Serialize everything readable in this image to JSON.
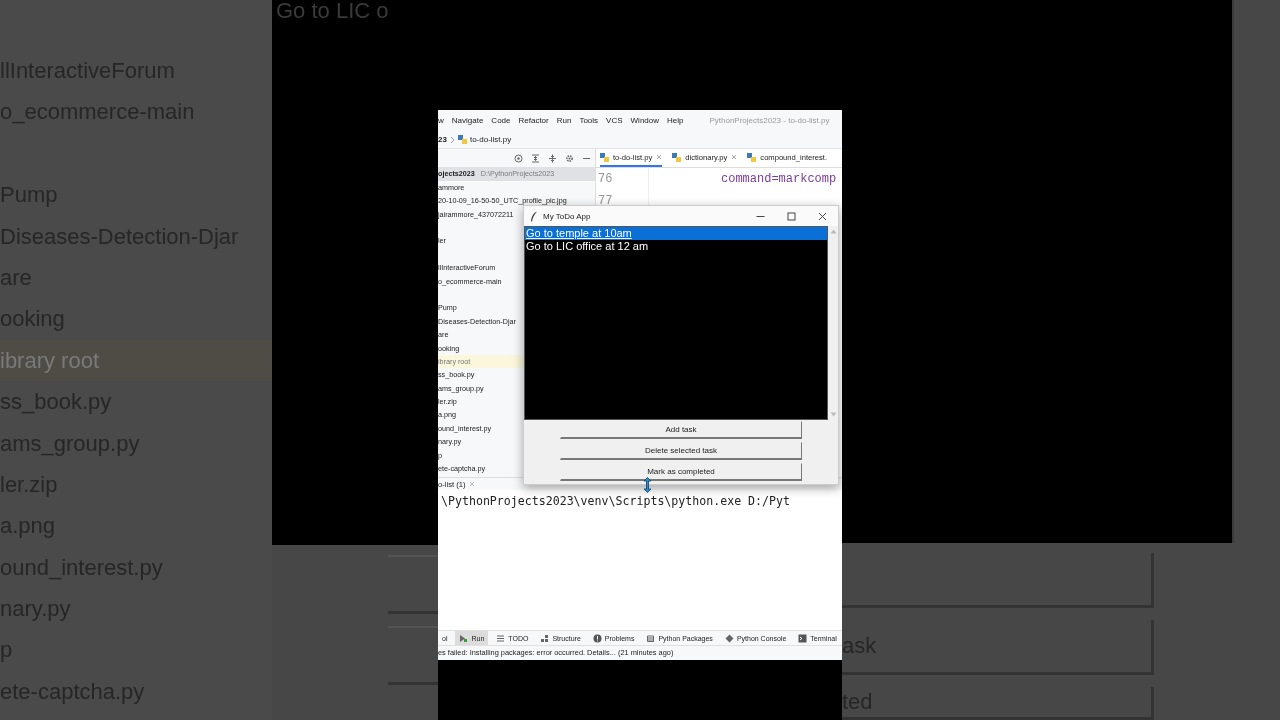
{
  "backdrop": {
    "top_text": "Go to LIC o",
    "left_items": [
      {
        "label": "llInteractiveForum",
        "kind": "item"
      },
      {
        "label": "o_ecommerce-main",
        "kind": "item"
      },
      {
        "kind": "blank"
      },
      {
        "label": "Pump",
        "kind": "item"
      },
      {
        "label": "Diseases-Detection-Djar",
        "kind": "item"
      },
      {
        "label": "are",
        "kind": "item"
      },
      {
        "label": "ooking",
        "kind": "item"
      },
      {
        "label": "ibrary root",
        "kind": "library"
      },
      {
        "label": "ss_book.py",
        "kind": "item"
      },
      {
        "label": "ams_group.py",
        "kind": "item"
      },
      {
        "label": "ler.zip",
        "kind": "item"
      },
      {
        "label": "a.png",
        "kind": "item"
      },
      {
        "label": "ound_interest.py",
        "kind": "item"
      },
      {
        "label": "nary.py",
        "kind": "item"
      },
      {
        "label": "p",
        "kind": "item"
      },
      {
        "label": "ete-captcha.py",
        "kind": "item"
      }
    ],
    "right_texts": [
      "ask",
      "ted"
    ]
  },
  "ide": {
    "menu": [
      "w",
      "Navigate",
      "Code",
      "Refactor",
      "Run",
      "Tools",
      "VCS",
      "Window",
      "Help"
    ],
    "window_title": "PythonProjects2023 - to-do-list.py",
    "breadcrumb": {
      "folder": "23",
      "file": "to-do-list.py"
    },
    "tabs": [
      {
        "label": "to-do-list.py",
        "selected": true,
        "closable": true
      },
      {
        "label": "dictionary.py",
        "selected": false,
        "closable": true
      },
      {
        "label": "compound_interest.",
        "selected": false,
        "closable": false
      }
    ],
    "project_tree": [
      {
        "label": "ojects2023",
        "path": "D:\\PythonProjects2023",
        "kind": "header"
      },
      {
        "label": "ammore",
        "kind": "item"
      },
      {
        "label": "20-10-09_16-50-50_UTC_profile_pic.jpg",
        "kind": "item"
      },
      {
        "label": "jairammore_437072211",
        "kind": "item"
      },
      {
        "kind": "blank"
      },
      {
        "label": "ler",
        "kind": "item"
      },
      {
        "kind": "blank"
      },
      {
        "label": "llInteractiveForum",
        "kind": "item"
      },
      {
        "label": "o_ecommerce-main",
        "kind": "item"
      },
      {
        "kind": "blank"
      },
      {
        "label": "Pump",
        "kind": "item"
      },
      {
        "label": "Diseases-Detection-Djar",
        "kind": "item"
      },
      {
        "label": "are",
        "kind": "item"
      },
      {
        "label": "ooking",
        "kind": "item"
      },
      {
        "label": "ibrary root",
        "kind": "library"
      },
      {
        "label": "ss_book.py",
        "kind": "item"
      },
      {
        "label": "ams_group.py",
        "kind": "item"
      },
      {
        "label": "ler.zip",
        "kind": "item"
      },
      {
        "label": "a.png",
        "kind": "item"
      },
      {
        "label": "ound_interest.py",
        "kind": "item"
      },
      {
        "label": "nary.py",
        "kind": "item"
      },
      {
        "label": "p",
        "kind": "item"
      },
      {
        "label": "ete-captcha.py",
        "kind": "item"
      }
    ],
    "editor_lines": [
      {
        "number": "76",
        "code": "command=markcomp"
      },
      {
        "number": "77"
      }
    ],
    "run_tab": "o-list (1)",
    "console_lines": [
      "\\PythonProjects2023\\venv\\Scripts\\python.exe D:/Pyt"
    ],
    "tool_tabs": [
      {
        "label": "ol",
        "selected": false
      },
      {
        "label": "Run",
        "selected": true
      },
      {
        "label": "TODO",
        "selected": false
      },
      {
        "label": "Structure",
        "selected": false
      },
      {
        "label": "Problems",
        "selected": false
      },
      {
        "label": "Python Packages",
        "selected": false
      },
      {
        "label": "Python Console",
        "selected": false
      },
      {
        "label": "Terminal",
        "selected": false
      }
    ],
    "status": "es failed: Installing packages: error occurred. Details... (21 minutes ago)"
  },
  "todo_app": {
    "title": "My ToDo App",
    "tasks": [
      {
        "text": "Go to temple at 10am",
        "selected": true
      },
      {
        "text": "Go to LIC office at 12 am",
        "selected": false
      }
    ],
    "buttons": [
      "Add task",
      "Delete selected task",
      "Mark as completed"
    ]
  }
}
